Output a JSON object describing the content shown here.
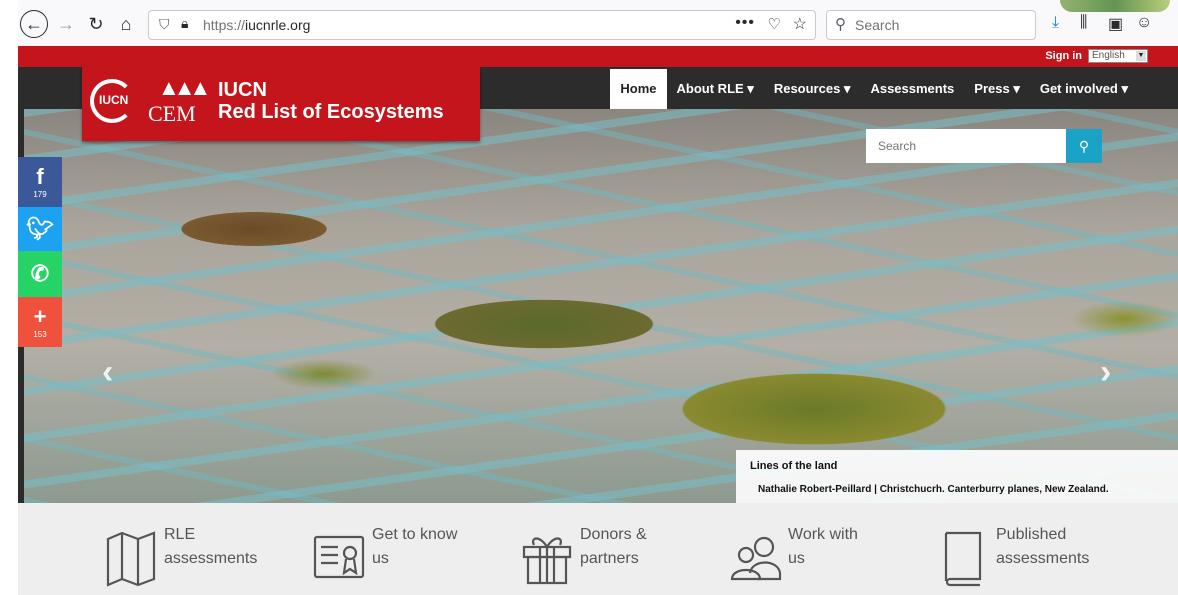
{
  "browser": {
    "url_prefix": "https://",
    "url_domain": "iucnrle.org",
    "search_placeholder": "Search"
  },
  "site": {
    "sign_in": "Sign in",
    "language": "English",
    "logo": {
      "iucn_badge": "IUCN",
      "cem": "CEM",
      "title_line1": "IUCN",
      "title_line2": "Red List of Ecosystems"
    },
    "nav": [
      {
        "label": "Home"
      },
      {
        "label": "About RLE ▾"
      },
      {
        "label": "Resources ▾"
      },
      {
        "label": "Assessments"
      },
      {
        "label": "Press ▾"
      },
      {
        "label": "Get involved ▾"
      }
    ],
    "search_placeholder": "Search",
    "slide": {
      "title": "Lines of the land",
      "credit": "Nathalie Robert-Peillard | Christchucrh. Canterburry planes, New Zealand.",
      "active_index": 1,
      "count": 5
    },
    "social": {
      "facebook_count": "179",
      "share_count": "153"
    },
    "features": [
      {
        "line1": "RLE",
        "line2": "assessments",
        "icon": "map-icon"
      },
      {
        "line1": "Get to know",
        "line2": "us",
        "icon": "certificate-icon"
      },
      {
        "line1": "Donors &",
        "line2": "partners",
        "icon": "gift-icon"
      },
      {
        "line1": "Work with",
        "line2": "us",
        "icon": "people-icon"
      },
      {
        "line1": "Published",
        "line2": "assessments",
        "icon": "book-icon"
      }
    ]
  },
  "colors": {
    "brand_red": "#c3151b",
    "search_button": "#1aa3c7",
    "facebook": "#3b5998",
    "twitter": "#1da1f2",
    "whatsapp": "#25d366",
    "share": "#f0513c"
  }
}
